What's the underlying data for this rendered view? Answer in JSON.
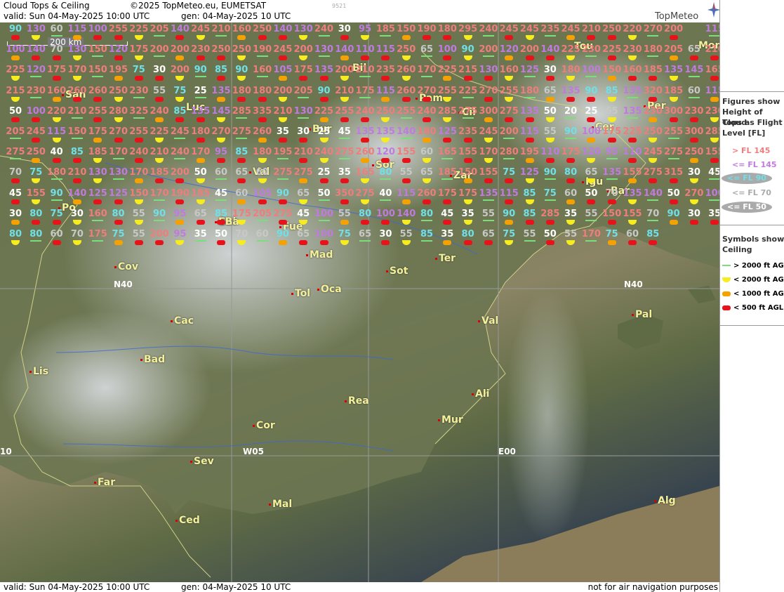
{
  "header": {
    "title": "Cloud Tops & Ceiling",
    "copyright": "©2025 TopMeteo.eu, EUMETSAT",
    "valid": "valid:  Sun  04-May-2025  10:00  UTC",
    "gen": "gen: 04-May-2025 10 UTC",
    "code": "9521",
    "logo": "TopMeteo"
  },
  "footer": {
    "valid": "valid:  Sun  04-May-2025  10:00  UTC",
    "gen": "gen: 04-May-2025 10 UTC",
    "disclaimer": "not for air navigation purposes"
  },
  "scale_label": "200 km",
  "coords": [
    "N40",
    "N40",
    "W05",
    "E00",
    "10"
  ],
  "cities": [
    "Tou",
    "Mon",
    "Bil",
    "Pam",
    "San",
    "Luc",
    "Cil",
    "Per",
    "Bur",
    "Cer",
    "Sor",
    "Zar",
    "Val",
    "Igu",
    "Bar",
    "Po",
    "Sal",
    "Fue",
    "EBa",
    "Mad",
    "Ter",
    "Cov",
    "Oca",
    "Sot",
    "Tol",
    "Val",
    "Pal",
    "Cac",
    "Bad",
    "Lis",
    "Ali",
    "Rea",
    "Mur",
    "Cor",
    "Sev",
    "Far",
    "Ced",
    "Mal",
    "Alg"
  ],
  "colors": {
    "gt145": "#f07d7d",
    "le145": "#c07ae0",
    "le90": "#6fe0e8",
    "le70": "#c8c8c8",
    "le50": "#ffffff",
    "green": "#7adf7a",
    "yellow": "#f6ec1e",
    "orange": "#f5a100",
    "red": "#e8121b"
  },
  "legend": {
    "title": [
      "Figures show",
      "Height of Cloud",
      "Tops as Flight",
      "Level  [FL]"
    ],
    "fl": [
      "> FL 145",
      "<= FL 145",
      "<= FL 90",
      "<= FL 70",
      "<= FL 50"
    ],
    "ceil_title": [
      "Symbols show",
      "Ceiling"
    ],
    "ceil": [
      "> 2000 ft AGL",
      "< 2000 ft AGL",
      "< 1000 ft AGL",
      "< 500 ft AGL"
    ]
  },
  "values": [
    "90",
    "130",
    "60",
    "115",
    "100",
    "255",
    "225",
    "205",
    "140",
    "245",
    "210",
    "160",
    "250",
    "140",
    "130",
    "240",
    "30",
    "95",
    "185",
    "150",
    "190",
    "180",
    "295",
    "240",
    "245",
    "245",
    "235",
    "245",
    "210",
    "250",
    "220",
    "270",
    "200",
    "Mon",
    "115",
    "100",
    "140",
    "70",
    "130",
    "150",
    "120",
    "175",
    "200",
    "200",
    "230",
    "250",
    "250",
    "190",
    "245",
    "200",
    "130",
    "140",
    "110",
    "115",
    "250",
    "65",
    "100",
    "90",
    "200",
    "120",
    "200",
    "140",
    "225",
    "230",
    "225",
    "230",
    "180",
    "205",
    "65",
    "210",
    "225",
    "120",
    "175",
    "170",
    "150",
    "195",
    "75",
    "30",
    "200",
    "90",
    "85",
    "90",
    "160",
    "105",
    "175",
    "135",
    "200",
    "210",
    "235",
    "260",
    "170",
    "225",
    "215",
    "130",
    "160",
    "125",
    "30",
    "180",
    "100",
    "150",
    "160",
    "185",
    "135",
    "145",
    "165",
    "215",
    "230",
    "160",
    "260",
    "260",
    "250",
    "230",
    "55",
    "75",
    "25",
    "135",
    "180",
    "180",
    "200",
    "205",
    "90",
    "210",
    "175",
    "115",
    "260",
    "270",
    "255",
    "225",
    "270",
    "255",
    "180",
    "65",
    "135",
    "90",
    "85",
    "135",
    "320",
    "185",
    "60",
    "115",
    "50",
    "100",
    "220",
    "210",
    "255",
    "280",
    "325",
    "240",
    "85",
    "135",
    "145",
    "285",
    "335",
    "210",
    "130",
    "225",
    "255",
    "240",
    "250",
    "255",
    "240",
    "285",
    "275",
    "300",
    "275",
    "135",
    "50",
    "20",
    "25",
    "65",
    "135",
    "230",
    "300",
    "230",
    "230",
    "205",
    "245",
    "115",
    "150",
    "175",
    "270",
    "255",
    "225",
    "245",
    "180",
    "270",
    "275",
    "260",
    "35",
    "30",
    "25",
    "45",
    "135",
    "135",
    "140",
    "180",
    "125",
    "235",
    "245",
    "200",
    "115",
    "55",
    "90",
    "100",
    "175",
    "225",
    "250",
    "255",
    "300",
    "285",
    "275",
    "250",
    "40",
    "85",
    "185",
    "170",
    "240",
    "210",
    "240",
    "170",
    "95",
    "85",
    "180",
    "195",
    "210",
    "240",
    "275",
    "260",
    "120",
    "155",
    "60",
    "165",
    "155",
    "170",
    "280",
    "195",
    "110",
    "175",
    "120",
    "95",
    "110",
    "245",
    "275",
    "250",
    "155",
    "70",
    "75",
    "180",
    "210",
    "130",
    "130",
    "170",
    "185",
    "200",
    "50",
    "60",
    "65",
    "60",
    "275",
    "275",
    "25",
    "35",
    "165",
    "80",
    "55",
    "65",
    "185",
    "150",
    "155",
    "75",
    "125",
    "90",
    "80",
    "65",
    "135",
    "155",
    "275",
    "315",
    "30",
    "45",
    "45",
    "155",
    "90",
    "140",
    "125",
    "125",
    "150",
    "170",
    "190",
    "185",
    "45",
    "60",
    "105",
    "90",
    "65",
    "50",
    "350",
    "275",
    "40",
    "115",
    "260",
    "175",
    "175",
    "135",
    "115",
    "85",
    "75",
    "60",
    "50",
    "70",
    "135",
    "140",
    "50",
    "270",
    "100",
    "30",
    "80",
    "75",
    "30",
    "160",
    "80",
    "55",
    "90",
    "95",
    "65",
    "85",
    "175",
    "205",
    "275",
    "45",
    "100",
    "55",
    "80",
    "100",
    "140",
    "80",
    "45",
    "35",
    "55",
    "90",
    "85",
    "285",
    "35",
    "55",
    "150",
    "155",
    "70",
    "90",
    "30",
    "35",
    "80",
    "80",
    "60",
    "70",
    "175",
    "75",
    "55",
    "200",
    "95",
    "35",
    "50",
    "70",
    "60",
    "90",
    "65",
    "100",
    "75",
    "65",
    "30",
    "55",
    "85",
    "35",
    "80",
    "65",
    "75",
    "55",
    "50",
    "55",
    "170",
    "75",
    "60",
    "85"
  ]
}
